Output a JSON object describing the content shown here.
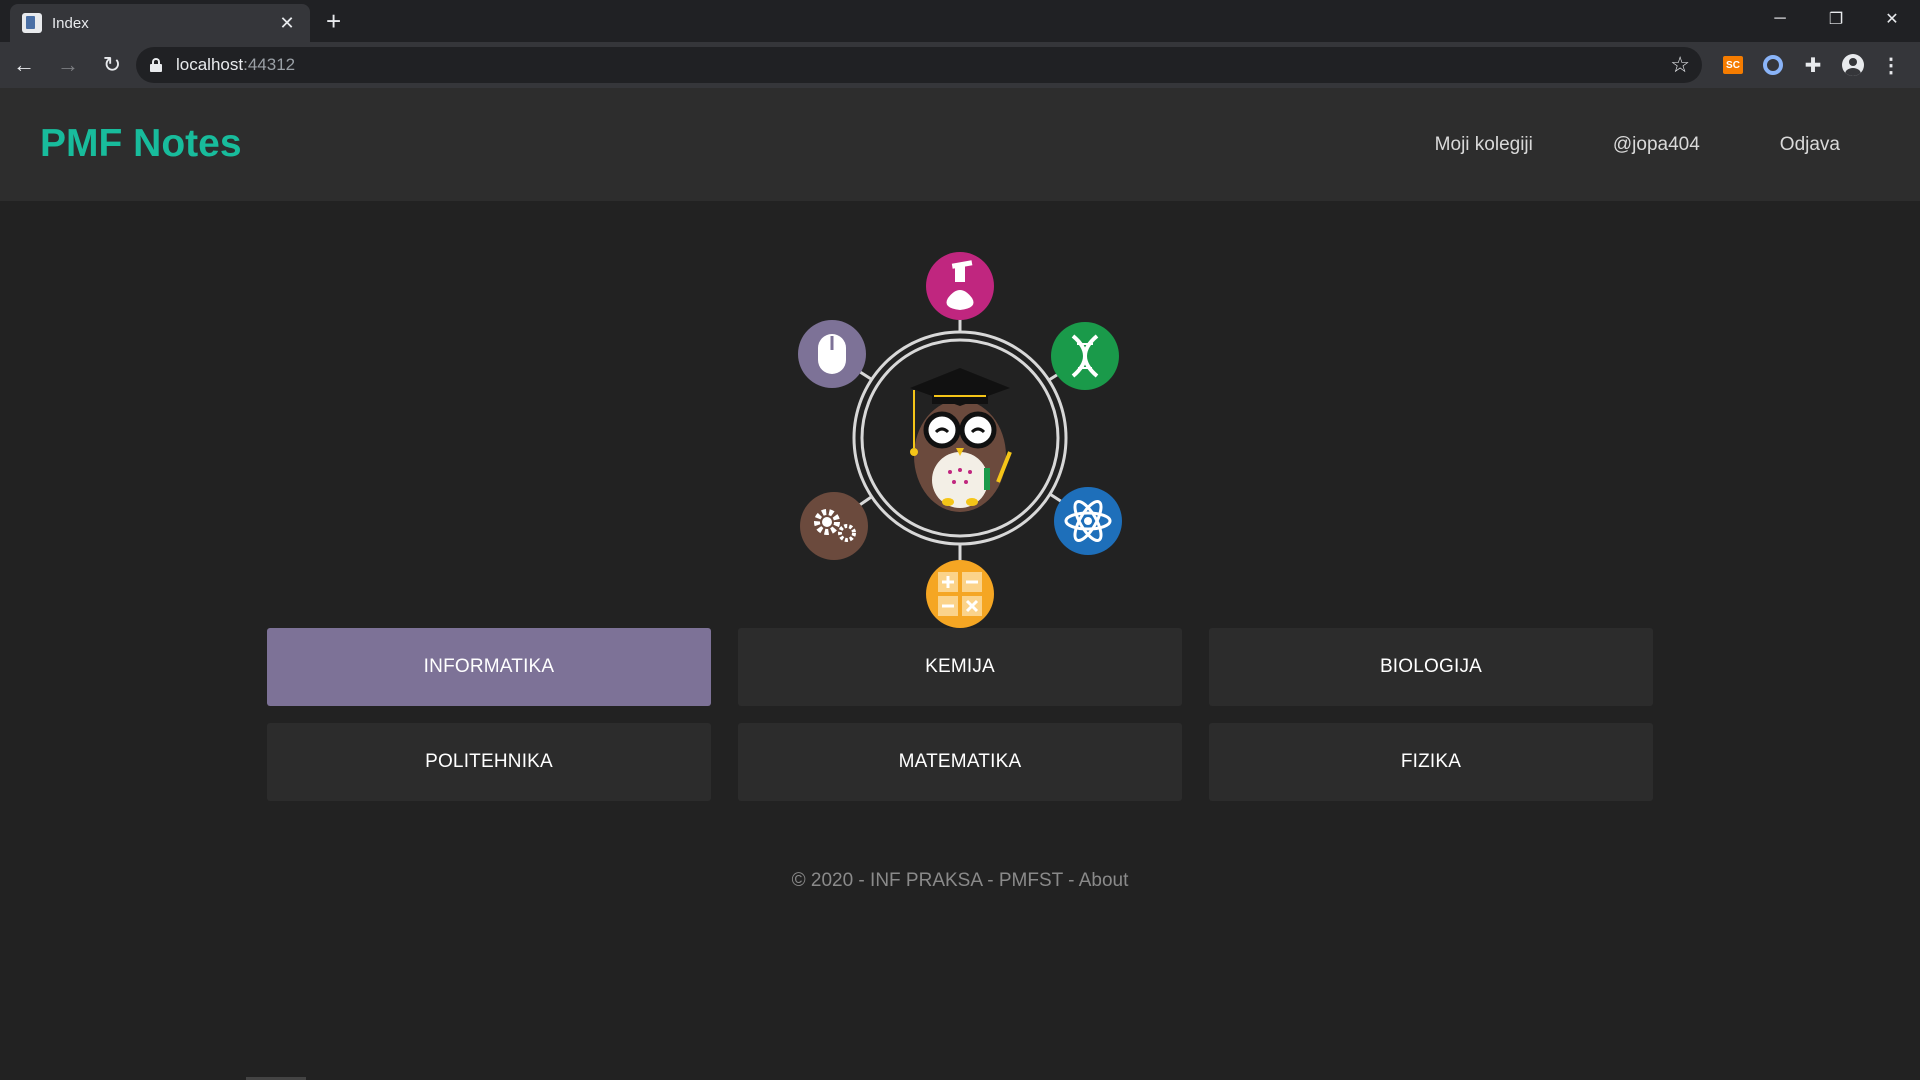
{
  "browser": {
    "tab_title": "Index",
    "url_host": "localhost",
    "url_port": ":44312",
    "extension_sc_label": "SC"
  },
  "header": {
    "brand": "PMF Notes",
    "nav": [
      {
        "label": "Moji kolegiji"
      },
      {
        "label": "@jopa404"
      },
      {
        "label": "Odjava"
      }
    ]
  },
  "hero": {
    "icons": [
      "flask-icon",
      "dna-icon",
      "atom-icon",
      "calculator-icon",
      "gears-icon",
      "mouse-icon",
      "owl-graduate-icon"
    ],
    "colors": {
      "flask": "#c0267f",
      "dna": "#1a9a4a",
      "atom": "#1e6fba",
      "calculator": "#f5a623",
      "gears": "#6b4a3d",
      "mouse": "#7d7297"
    }
  },
  "subjects": [
    {
      "label": "INFORMATIKA",
      "active": true
    },
    {
      "label": "KEMIJA",
      "active": false
    },
    {
      "label": "BIOLOGIJA",
      "active": false
    },
    {
      "label": "POLITEHNIKA",
      "active": false
    },
    {
      "label": "MATEMATIKA",
      "active": false
    },
    {
      "label": "FIZIKA",
      "active": false
    }
  ],
  "footer": {
    "text": "© 2020 - INF PRAKSA - PMFST - ",
    "about_link": "About"
  },
  "colors": {
    "accent": "#18bc9c",
    "active_subject": "#7d7297",
    "background": "#222222",
    "header_bg": "#2d2d2d"
  }
}
